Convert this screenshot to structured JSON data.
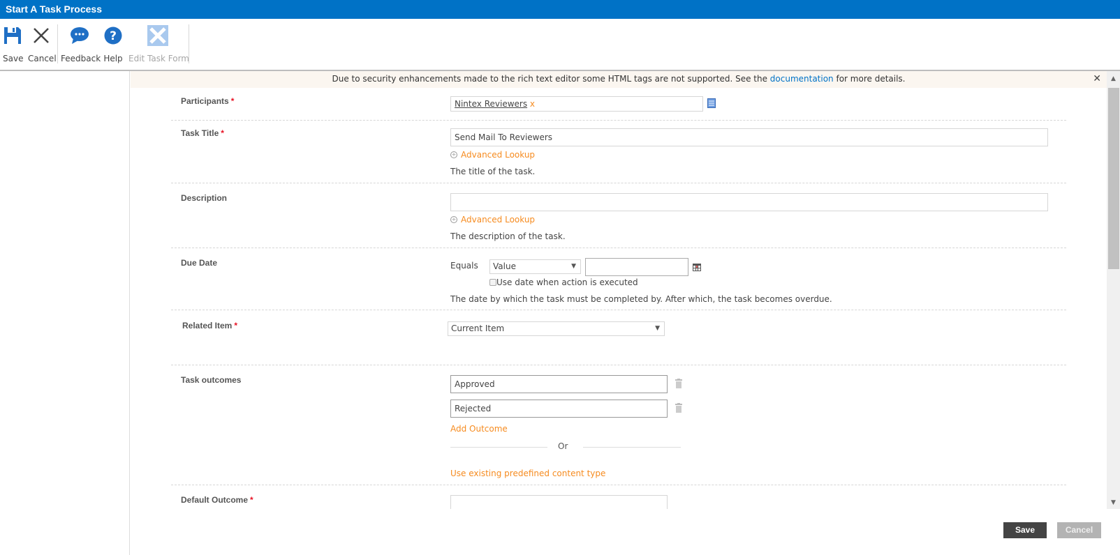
{
  "window": {
    "title": "Start A Task Process"
  },
  "ribbon": {
    "save": "Save",
    "cancel": "Cancel",
    "feedback": "Feedback",
    "help": "Help",
    "edit_task_form": "Edit Task Form"
  },
  "notice": {
    "text_before": "Due to security enhancements made to the rich text editor some HTML tags are not supported. See the ",
    "link": "documentation",
    "text_after": " for more details.",
    "close": "✕"
  },
  "form": {
    "participants": {
      "label": "Participants",
      "required": "*",
      "value": "Nintex Reviewers",
      "remove": "x"
    },
    "task_title": {
      "label": "Task Title",
      "required": "*",
      "value": "Send Mail To Reviewers",
      "lookup": "Advanced Lookup",
      "help": "The title of the task."
    },
    "description": {
      "label": "Description",
      "value": "",
      "lookup": "Advanced Lookup",
      "help": "The description of the task."
    },
    "due_date": {
      "label": "Due Date",
      "operator": "Equals",
      "type_selected": "Value",
      "value": "",
      "checkbox_label": "Use date when action is executed",
      "checkbox_checked": false,
      "help": "The date by which the task must be completed by. After which, the task becomes overdue."
    },
    "related_item": {
      "label": "Related Item",
      "required": "*",
      "selected": "Current Item"
    },
    "task_outcomes": {
      "label": "Task outcomes",
      "outcomes": [
        "Approved",
        "Rejected"
      ],
      "add": "Add Outcome",
      "or": "Or",
      "predefined": "Use existing predefined content type"
    },
    "default_outcome": {
      "label": "Default Outcome",
      "required": "*"
    }
  },
  "footer": {
    "save": "Save",
    "cancel": "Cancel"
  },
  "colors": {
    "brand": "#0072c6",
    "accent_link": "#f68b1f",
    "required": "#e81123"
  }
}
